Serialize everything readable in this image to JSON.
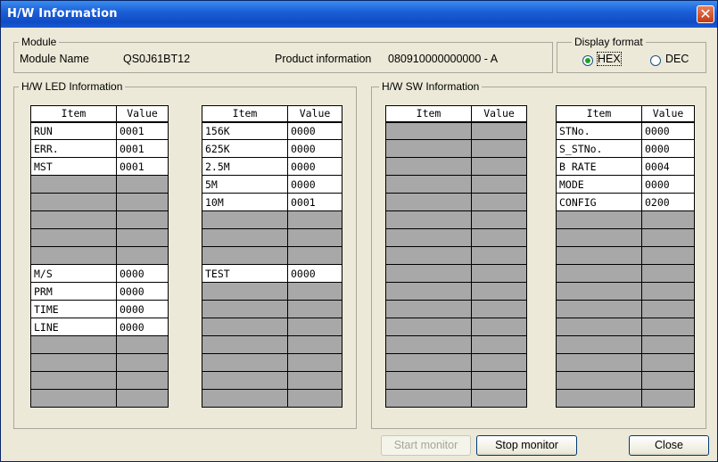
{
  "window": {
    "title": "H/W Information",
    "close_glyph": "✕"
  },
  "module": {
    "legend": "Module",
    "name_label": "Module Name",
    "name_value": "QS0J61BT12",
    "product_label": "Product information",
    "product_value": "080910000000000 - A"
  },
  "display_format": {
    "legend": "Display format",
    "options": [
      {
        "label": "HEX",
        "selected": true
      },
      {
        "label": "DEC",
        "selected": false
      }
    ]
  },
  "led": {
    "legend": "H/W LED Information",
    "col_item": "Item",
    "col_value": "Value",
    "table1": [
      [
        "RUN",
        "0001"
      ],
      [
        "ERR.",
        "0001"
      ],
      [
        "MST",
        "0001"
      ],
      [
        "",
        ""
      ],
      [
        "",
        ""
      ],
      [
        "",
        ""
      ],
      [
        "",
        ""
      ],
      [
        "",
        ""
      ],
      [
        "M/S",
        "0000"
      ],
      [
        "PRM",
        "0000"
      ],
      [
        "TIME",
        "0000"
      ],
      [
        "LINE",
        "0000"
      ],
      [
        "",
        ""
      ],
      [
        "",
        ""
      ],
      [
        "",
        ""
      ],
      [
        "",
        ""
      ]
    ],
    "table2": [
      [
        "156K",
        "0000"
      ],
      [
        "625K",
        "0000"
      ],
      [
        "2.5M",
        "0000"
      ],
      [
        "5M",
        "0000"
      ],
      [
        "10M",
        "0001"
      ],
      [
        "",
        ""
      ],
      [
        "",
        ""
      ],
      [
        "",
        ""
      ],
      [
        "TEST",
        "0000"
      ],
      [
        "",
        ""
      ],
      [
        "",
        ""
      ],
      [
        "",
        ""
      ],
      [
        "",
        ""
      ],
      [
        "",
        ""
      ],
      [
        "",
        ""
      ],
      [
        "",
        ""
      ]
    ]
  },
  "sw": {
    "legend": "H/W SW Information",
    "col_item": "Item",
    "col_value": "Value",
    "table1": [
      [
        "",
        ""
      ],
      [
        "",
        ""
      ],
      [
        "",
        ""
      ],
      [
        "",
        ""
      ],
      [
        "",
        ""
      ],
      [
        "",
        ""
      ],
      [
        "",
        ""
      ],
      [
        "",
        ""
      ],
      [
        "",
        ""
      ],
      [
        "",
        ""
      ],
      [
        "",
        ""
      ],
      [
        "",
        ""
      ],
      [
        "",
        ""
      ],
      [
        "",
        ""
      ],
      [
        "",
        ""
      ],
      [
        "",
        ""
      ]
    ],
    "table2": [
      [
        "STNo.",
        "0000"
      ],
      [
        "S_STNo.",
        "0000"
      ],
      [
        "B RATE",
        "0004"
      ],
      [
        "MODE",
        "0000"
      ],
      [
        "CONFIG",
        "0200"
      ],
      [
        "",
        ""
      ],
      [
        "",
        ""
      ],
      [
        "",
        ""
      ],
      [
        "",
        ""
      ],
      [
        "",
        ""
      ],
      [
        "",
        ""
      ],
      [
        "",
        ""
      ],
      [
        "",
        ""
      ],
      [
        "",
        ""
      ],
      [
        "",
        ""
      ],
      [
        "",
        ""
      ]
    ]
  },
  "buttons": {
    "start": "Start monitor",
    "stop": "Stop monitor",
    "close": "Close"
  }
}
